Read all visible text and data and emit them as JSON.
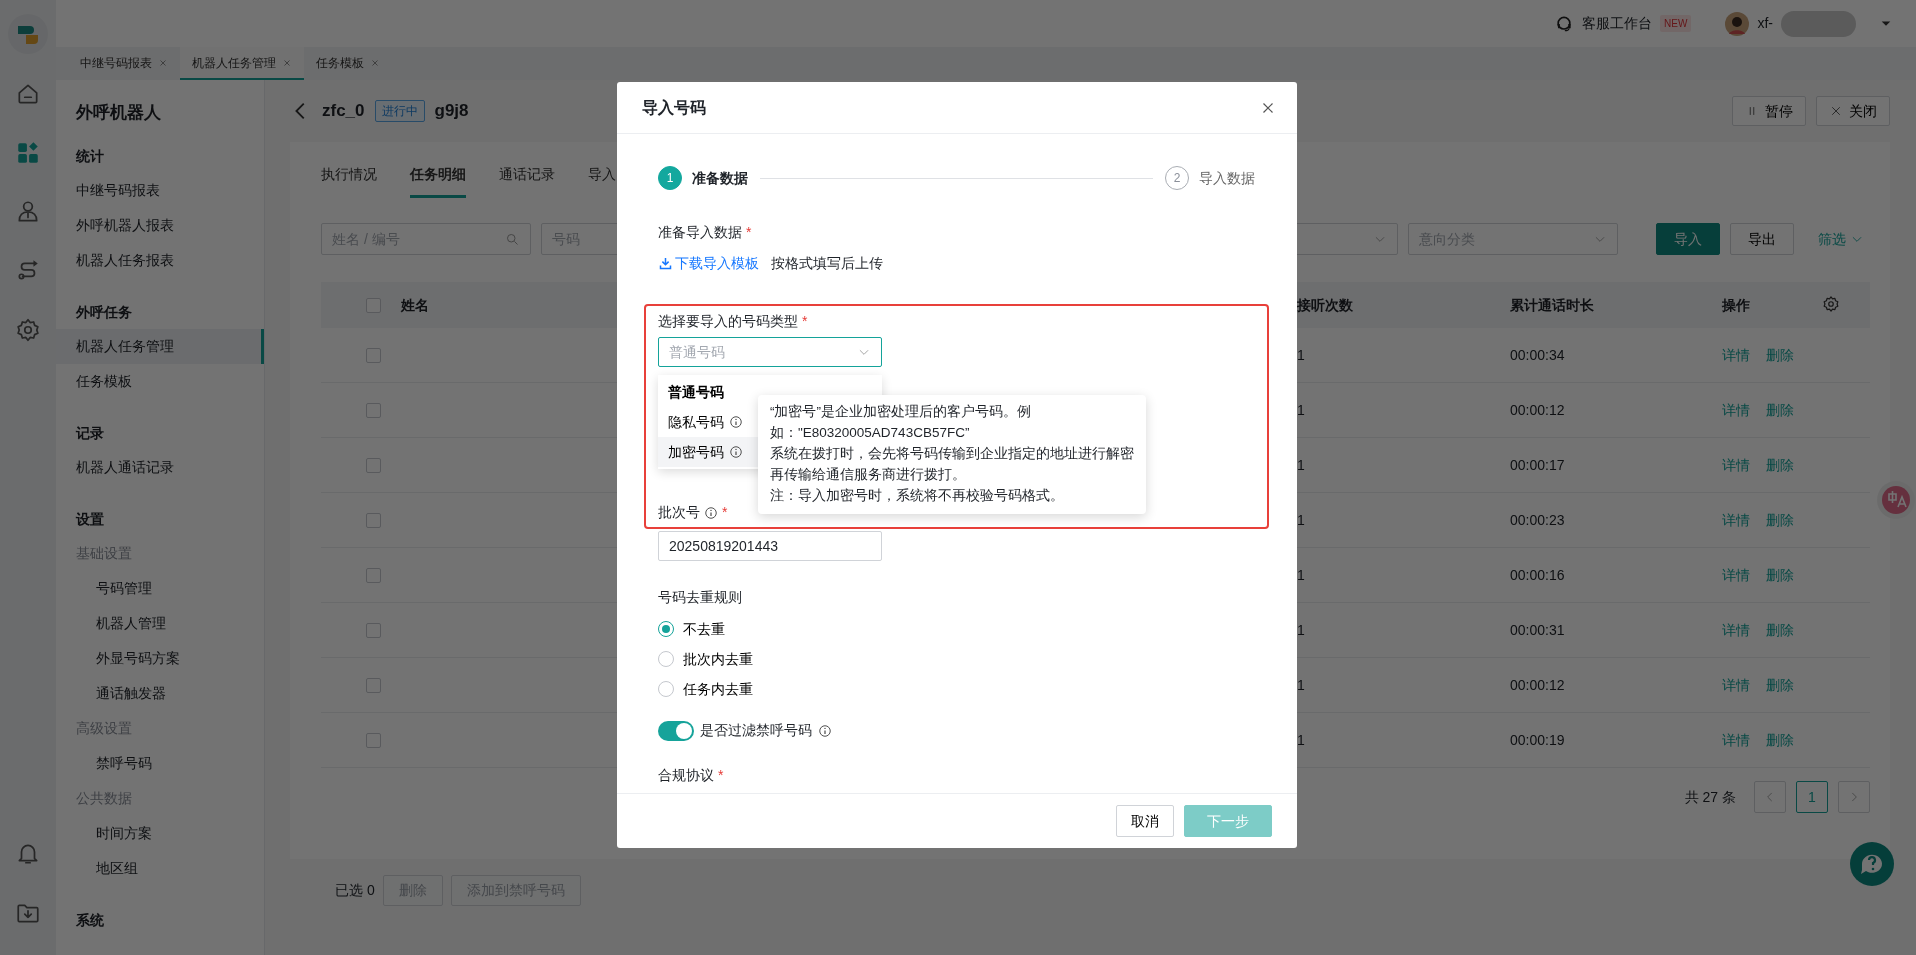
{
  "rail": {
    "top": [
      {
        "kind": "home",
        "selected": false
      },
      {
        "kind": "apps",
        "selected": true
      },
      {
        "kind": "user",
        "selected": false
      },
      {
        "kind": "route",
        "selected": false
      },
      {
        "kind": "gear",
        "selected": false
      }
    ],
    "bottom": [
      {
        "kind": "bell"
      },
      {
        "kind": "download"
      }
    ]
  },
  "header": {
    "workbench": "客服工作台",
    "badge": "NEW",
    "user": "xf-"
  },
  "page_tabs": [
    {
      "label": "中继号码报表",
      "selected": false
    },
    {
      "label": "机器人任务管理",
      "selected": true
    },
    {
      "label": "任务模板",
      "selected": false
    }
  ],
  "sidebar": {
    "title": "外呼机器人",
    "sections": [
      {
        "heading": "统计",
        "items": [
          {
            "label": "中继号码报表",
            "selected": false
          },
          {
            "label": "外呼机器人报表",
            "selected": false
          },
          {
            "label": "机器人任务报表",
            "selected": false
          }
        ]
      },
      {
        "heading": "外呼任务",
        "items": [
          {
            "label": "机器人任务管理",
            "selected": true
          },
          {
            "label": "任务模板",
            "selected": false
          }
        ]
      },
      {
        "heading": "记录",
        "items": [
          {
            "label": "机器人通话记录",
            "selected": false
          }
        ]
      },
      {
        "heading": "设置",
        "groups": [
          {
            "label": "基础设置",
            "items": [
              {
                "label": "号码管理",
                "selected": false
              },
              {
                "label": "机器人管理",
                "selected": false
              },
              {
                "label": "外显号码方案",
                "selected": false
              },
              {
                "label": "通话触发器",
                "selected": false
              }
            ]
          },
          {
            "label": "高级设置",
            "items": [
              {
                "label": "禁呼号码",
                "selected": false
              }
            ]
          },
          {
            "label": "公共数据",
            "items": [
              {
                "label": "时间方案",
                "selected": false
              },
              {
                "label": "地区组",
                "selected": false
              }
            ]
          }
        ]
      },
      {
        "heading": "系统"
      }
    ]
  },
  "task": {
    "name": "zfc_0",
    "status": "进行中",
    "code": "g9j8",
    "actions": [
      {
        "label": "暂停",
        "kind": "pause"
      },
      {
        "label": "关闭",
        "kind": "close"
      }
    ]
  },
  "content_tabs": [
    {
      "label": "执行情况",
      "selected": false
    },
    {
      "label": "任务明细",
      "selected": true
    },
    {
      "label": "通话记录",
      "selected": false
    },
    {
      "label": "导入",
      "selected": false
    }
  ],
  "filters": {
    "search_placeholder": "姓名 / 编号",
    "number_placeholder": "号码",
    "category_placeholder": "意向分类",
    "actions": [
      {
        "label": "导入",
        "kind": "primary"
      },
      {
        "label": "导出",
        "kind": "default"
      }
    ],
    "filter_link": "筛选"
  },
  "table": {
    "select_all_checked": false,
    "columns": [
      "姓名",
      "接听次数",
      "累计通话时长",
      "操作"
    ],
    "rows": [
      {
        "checked": false,
        "answered": "1",
        "duration": "00:00:34",
        "actions": [
          "详情",
          "删除"
        ]
      },
      {
        "checked": false,
        "answered": "1",
        "duration": "00:00:12",
        "actions": [
          "详情",
          "删除"
        ]
      },
      {
        "checked": false,
        "answered": "1",
        "duration": "00:00:17",
        "actions": [
          "详情",
          "删除"
        ]
      },
      {
        "checked": false,
        "answered": "1",
        "duration": "00:00:23",
        "actions": [
          "详情",
          "删除"
        ]
      },
      {
        "checked": false,
        "answered": "1",
        "duration": "00:00:16",
        "actions": [
          "详情",
          "删除"
        ]
      },
      {
        "checked": false,
        "answered": "1",
        "duration": "00:00:31",
        "actions": [
          "详情",
          "删除"
        ]
      },
      {
        "checked": false,
        "answered": "1",
        "duration": "00:00:12",
        "actions": [
          "详情",
          "删除"
        ]
      },
      {
        "checked": false,
        "answered": "1",
        "duration": "00:00:19",
        "actions": [
          "详情",
          "删除"
        ]
      }
    ]
  },
  "pagination": {
    "total": "共 27 条",
    "pages": [
      {
        "label": "1",
        "selected": true
      }
    ]
  },
  "bulk": {
    "selected_count": "已选 0",
    "actions": [
      "删除",
      "添加到禁呼号码"
    ]
  },
  "modal": {
    "title": "导入号码",
    "steps": [
      {
        "number": "1",
        "label": "准备数据",
        "selected": true
      },
      {
        "number": "2",
        "label": "导入数据",
        "selected": false
      }
    ],
    "prepare": {
      "label": "准备导入数据",
      "required_mark": "*",
      "link": "下载导入模板",
      "hint": "按格式填写后上传"
    },
    "type_field": {
      "label": "选择要导入的号码类型",
      "required_mark": "*",
      "highlighted": true,
      "placeholder": "普通号码",
      "options": [
        {
          "label": "普通号码",
          "selected": true,
          "info": false,
          "hovered": false
        },
        {
          "label": "隐私号码",
          "selected": false,
          "info": true,
          "hovered": false
        },
        {
          "label": "加密号码",
          "selected": false,
          "info": true,
          "hovered": true
        }
      ],
      "tooltip": [
        "“加密号”是企业加密处理后的客户号码。例",
        "如：\"E80320005AD743CB57FC”",
        "系统在拨打时，会先将号码传输到企业指定的地址进行解密",
        "再传输给通信服务商进行拨打。",
        "注：导入加密号时，系统将不再校验号码格式。"
      ]
    },
    "batch": {
      "label": "批次号",
      "info": true,
      "required_mark": "*",
      "value": "20250819201443"
    },
    "dedup": {
      "label": "号码去重规则",
      "options": [
        {
          "label": "不去重",
          "selected": true
        },
        {
          "label": "批次内去重",
          "selected": false
        },
        {
          "label": "任务内去重",
          "selected": false
        }
      ]
    },
    "filter_toggle": {
      "label": "是否过滤禁呼号码",
      "on": true,
      "info": true
    },
    "compliance": {
      "label": "合规协议",
      "required_mark": "*"
    },
    "buttons": [
      {
        "label": "取消",
        "kind": "default",
        "disabled": false
      },
      {
        "label": "下一步",
        "kind": "primary",
        "disabled": true
      }
    ]
  }
}
